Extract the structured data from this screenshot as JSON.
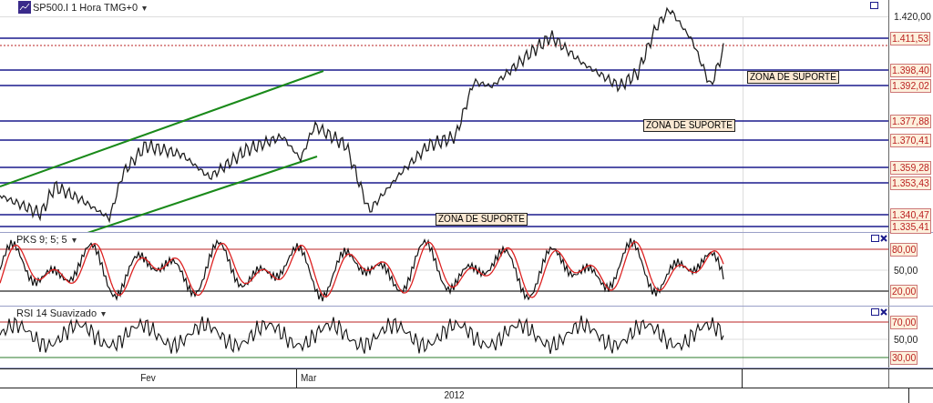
{
  "chart": {
    "title": "SP500.I 1 Hora TMG+0",
    "caret": "▾",
    "price_ticks": [
      "1.420,00"
    ],
    "levels": [
      {
        "label": "1.411,53"
      },
      {
        "label": "1.398,40"
      },
      {
        "label": "1.392,02"
      },
      {
        "label": "1.377,88"
      },
      {
        "label": "1.370,41"
      },
      {
        "label": "1.359,28"
      },
      {
        "label": "1.353,43"
      },
      {
        "label": "1.340,47"
      },
      {
        "label": "1.335,41"
      }
    ],
    "zones": [
      {
        "label": "ZONA DE SUPORTE"
      },
      {
        "label": "ZONA DE SUPORTE"
      },
      {
        "label": "ZONA DE SUPORTE"
      }
    ]
  },
  "indicators": [
    {
      "title": "PKS 9; 5; 5",
      "caret": "▾",
      "kind": "stochastic",
      "ticks": [
        {
          "label": "80,00",
          "kind": "boxed"
        },
        {
          "label": "50,00",
          "kind": "plain"
        },
        {
          "label": "20,00",
          "kind": "boxed"
        }
      ]
    },
    {
      "title": "RSI 14 Suavizado",
      "caret": "▾",
      "kind": "rsi",
      "ticks": [
        {
          "label": "70,00",
          "kind": "boxed"
        },
        {
          "label": "50,00",
          "kind": "plain"
        },
        {
          "label": "30,00",
          "kind": "boxed"
        }
      ]
    }
  ],
  "time_axis": {
    "months": [
      "Fev",
      "Mar"
    ],
    "year": "2012"
  }
}
